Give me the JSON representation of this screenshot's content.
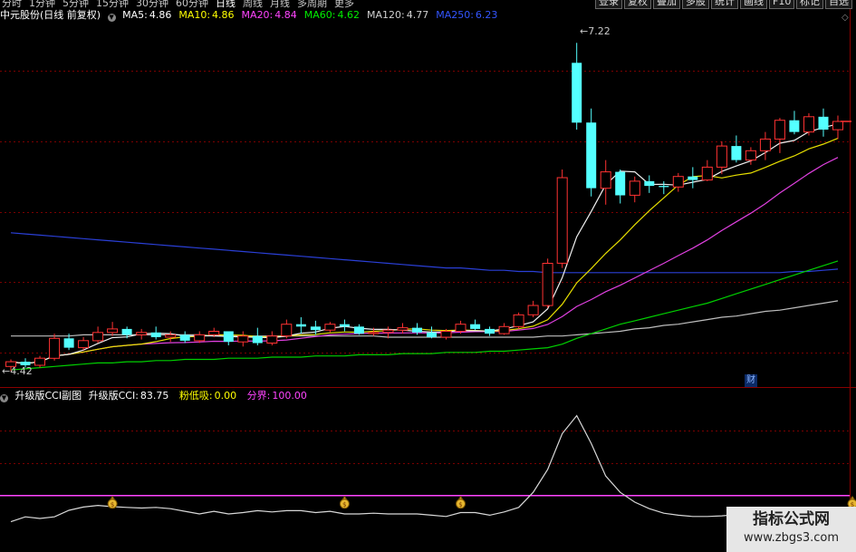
{
  "periods": [
    "分时",
    "1分钟",
    "5分钟",
    "15分钟",
    "30分钟",
    "60分钟",
    "日线",
    "周线",
    "月线",
    "多周期",
    "更多"
  ],
  "active_period": "日线",
  "toolbar": [
    "登录",
    "复权",
    "叠加",
    "多股",
    "统计",
    "画线",
    "F10",
    "标记",
    "自选"
  ],
  "stock": {
    "name": "中元股份",
    "mode": "(日线 前复权)"
  },
  "ma": [
    {
      "label": "MA5:",
      "value": "4.86",
      "color": "#ffffff"
    },
    {
      "label": "MA10:",
      "value": "4.86",
      "color": "#ffff00"
    },
    {
      "label": "MA20:",
      "value": "4.84",
      "color": "#ff44ff"
    },
    {
      "label": "MA60:",
      "value": "4.62",
      "color": "#00ee00"
    },
    {
      "label": "MA120:",
      "value": "4.77",
      "color": "#d0d0d0"
    },
    {
      "label": "MA250:",
      "value": "6.23",
      "color": "#3355ff"
    }
  ],
  "price_high_label": "7.22",
  "price_low_label": "4.42",
  "cai_badge": "财",
  "indicator": {
    "name": "升级版CCI副图",
    "cci_label": "升级版CCI:",
    "cci_value": "83.75",
    "low_label": "粉低吸:",
    "low_value": "0.00",
    "boundary_label": "分界:",
    "boundary_value": "100.00"
  },
  "colors": {
    "up": "#ff3232",
    "down": "#54ffff",
    "grid": "#7a0000",
    "cci": "#d8d8d8",
    "boundary": "#ff44ff"
  },
  "watermark": {
    "line1": "指标公式网",
    "line2": "www.zbgs3.com"
  },
  "candles": [
    [
      4.46,
      4.52,
      4.42,
      4.5
    ],
    [
      4.5,
      4.53,
      4.45,
      4.47
    ],
    [
      4.47,
      4.55,
      4.45,
      4.53
    ],
    [
      4.53,
      4.74,
      4.51,
      4.7
    ],
    [
      4.7,
      4.74,
      4.6,
      4.62
    ],
    [
      4.62,
      4.71,
      4.6,
      4.68
    ],
    [
      4.68,
      4.8,
      4.66,
      4.75
    ],
    [
      4.75,
      4.84,
      4.72,
      4.78
    ],
    [
      4.78,
      4.8,
      4.7,
      4.73
    ],
    [
      4.73,
      4.78,
      4.69,
      4.75
    ],
    [
      4.75,
      4.8,
      4.69,
      4.71
    ],
    [
      4.71,
      4.76,
      4.67,
      4.73
    ],
    [
      4.73,
      4.76,
      4.66,
      4.68
    ],
    [
      4.68,
      4.76,
      4.66,
      4.73
    ],
    [
      4.73,
      4.79,
      4.71,
      4.76
    ],
    [
      4.76,
      4.76,
      4.64,
      4.67
    ],
    [
      4.67,
      4.76,
      4.63,
      4.72
    ],
    [
      4.72,
      4.79,
      4.64,
      4.66
    ],
    [
      4.66,
      4.76,
      4.64,
      4.72
    ],
    [
      4.72,
      4.86,
      4.7,
      4.82
    ],
    [
      4.82,
      4.88,
      4.74,
      4.8
    ],
    [
      4.8,
      4.85,
      4.73,
      4.77
    ],
    [
      4.77,
      4.84,
      4.75,
      4.82
    ],
    [
      4.82,
      4.86,
      4.76,
      4.8
    ],
    [
      4.8,
      4.82,
      4.73,
      4.74
    ],
    [
      4.74,
      4.79,
      4.72,
      4.75
    ],
    [
      4.75,
      4.8,
      4.7,
      4.77
    ],
    [
      4.77,
      4.83,
      4.74,
      4.79
    ],
    [
      4.79,
      4.83,
      4.73,
      4.75
    ],
    [
      4.75,
      4.8,
      4.7,
      4.71
    ],
    [
      4.71,
      4.78,
      4.69,
      4.76
    ],
    [
      4.76,
      4.85,
      4.74,
      4.82
    ],
    [
      4.82,
      4.86,
      4.77,
      4.78
    ],
    [
      4.78,
      4.8,
      4.72,
      4.74
    ],
    [
      4.74,
      4.83,
      4.73,
      4.8
    ],
    [
      4.8,
      4.92,
      4.78,
      4.9
    ],
    [
      4.9,
      5.02,
      4.88,
      4.98
    ],
    [
      4.98,
      5.38,
      4.96,
      5.34
    ],
    [
      5.34,
      6.14,
      5.3,
      6.07
    ],
    [
      7.05,
      7.22,
      6.48,
      6.54
    ],
    [
      6.54,
      6.66,
      5.91,
      5.98
    ],
    [
      5.98,
      6.22,
      5.84,
      6.12
    ],
    [
      6.12,
      6.14,
      5.85,
      5.92
    ],
    [
      5.92,
      6.08,
      5.86,
      6.04
    ],
    [
      6.04,
      6.09,
      5.94,
      6.0
    ],
    [
      6.0,
      6.04,
      5.93,
      5.99
    ],
    [
      5.99,
      6.11,
      5.95,
      6.08
    ],
    [
      6.08,
      6.16,
      5.98,
      6.05
    ],
    [
      6.05,
      6.22,
      6.04,
      6.16
    ],
    [
      6.16,
      6.38,
      6.1,
      6.34
    ],
    [
      6.34,
      6.43,
      6.2,
      6.22
    ],
    [
      6.22,
      6.33,
      6.18,
      6.3
    ],
    [
      6.3,
      6.46,
      6.22,
      6.4
    ],
    [
      6.4,
      6.58,
      6.28,
      6.56
    ],
    [
      6.56,
      6.64,
      6.44,
      6.46
    ],
    [
      6.46,
      6.62,
      6.43,
      6.59
    ],
    [
      6.59,
      6.66,
      6.42,
      6.48
    ],
    [
      6.48,
      6.6,
      6.4,
      6.55
    ]
  ],
  "ma60_series": [
    4.43,
    4.44,
    4.45,
    4.46,
    4.47,
    4.48,
    4.49,
    4.49,
    4.5,
    4.5,
    4.51,
    4.51,
    4.52,
    4.52,
    4.52,
    4.53,
    4.53,
    4.53,
    4.54,
    4.54,
    4.54,
    4.55,
    4.55,
    4.55,
    4.56,
    4.56,
    4.56,
    4.57,
    4.57,
    4.57,
    4.58,
    4.58,
    4.58,
    4.59,
    4.59,
    4.6,
    4.61,
    4.62,
    4.65,
    4.7,
    4.74,
    4.78,
    4.82,
    4.85,
    4.88,
    4.91,
    4.94,
    4.97,
    5.0,
    5.04,
    5.08,
    5.12,
    5.16,
    5.2,
    5.24,
    5.28,
    5.32,
    5.36
  ],
  "ma120_series": [
    4.72,
    4.72,
    4.72,
    4.72,
    4.72,
    4.73,
    4.73,
    4.73,
    4.73,
    4.73,
    4.73,
    4.73,
    4.73,
    4.73,
    4.72,
    4.72,
    4.72,
    4.72,
    4.72,
    4.72,
    4.72,
    4.72,
    4.72,
    4.72,
    4.72,
    4.72,
    4.71,
    4.71,
    4.71,
    4.71,
    4.71,
    4.71,
    4.71,
    4.71,
    4.71,
    4.71,
    4.71,
    4.72,
    4.72,
    4.73,
    4.74,
    4.75,
    4.76,
    4.78,
    4.79,
    4.81,
    4.82,
    4.84,
    4.86,
    4.88,
    4.89,
    4.91,
    4.93,
    4.94,
    4.96,
    4.98,
    5.0,
    5.02
  ],
  "ma250_series": [
    5.6,
    5.59,
    5.58,
    5.57,
    5.56,
    5.55,
    5.54,
    5.53,
    5.52,
    5.51,
    5.5,
    5.49,
    5.48,
    5.47,
    5.46,
    5.45,
    5.44,
    5.43,
    5.42,
    5.41,
    5.4,
    5.39,
    5.38,
    5.37,
    5.36,
    5.35,
    5.34,
    5.33,
    5.32,
    5.31,
    5.3,
    5.3,
    5.29,
    5.28,
    5.28,
    5.27,
    5.27,
    5.26,
    5.26,
    5.26,
    5.26,
    5.26,
    5.26,
    5.26,
    5.26,
    5.26,
    5.26,
    5.26,
    5.26,
    5.26,
    5.26,
    5.26,
    5.26,
    5.26,
    5.27,
    5.27,
    5.28,
    5.29
  ],
  "cci_series": [
    20,
    35,
    30,
    35,
    55,
    65,
    70,
    66,
    64,
    62,
    64,
    60,
    52,
    44,
    52,
    44,
    48,
    54,
    50,
    54,
    54,
    48,
    52,
    44,
    44,
    46,
    44,
    44,
    44,
    40,
    36,
    48,
    48,
    40,
    50,
    64,
    110,
    180,
    290,
    345,
    260,
    160,
    110,
    80,
    60,
    46,
    40,
    36,
    36,
    38,
    42,
    44,
    40,
    38,
    40,
    38,
    36,
    34
  ],
  "signal_indices": [
    7,
    23,
    31,
    58
  ],
  "boundary": 100,
  "cci_range": [
    -20,
    380
  ]
}
